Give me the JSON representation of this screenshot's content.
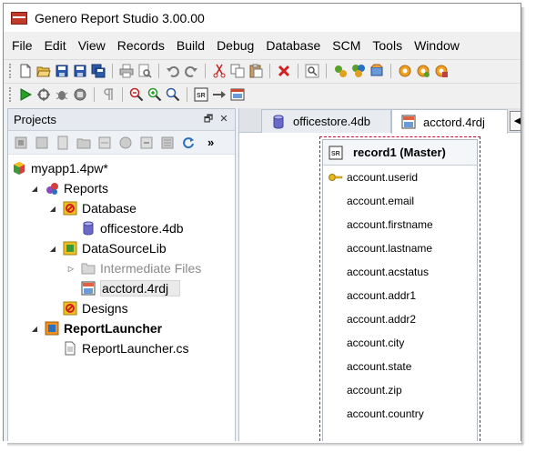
{
  "window": {
    "title": "Genero Report Studio 3.00.00"
  },
  "menu": [
    "File",
    "Edit",
    "View",
    "Records",
    "Build",
    "Debug",
    "Database",
    "SCM",
    "Tools",
    "Window"
  ],
  "toolbar_row1_icons": [
    "new-file-icon",
    "open-folder-icon",
    "save-icon",
    "save-as-icon",
    "save-all-icon",
    "print-icon",
    "print-preview-icon",
    "undo-icon",
    "redo-icon",
    "cut-icon",
    "copy-icon",
    "paste-icon",
    "delete-icon",
    "find-icon",
    "compile-icon",
    "compile-all-icon",
    "package-icon",
    "settings-gear-icon",
    "settings-gear-2-icon",
    "settings-gear-3-icon"
  ],
  "toolbar_row2_icons": [
    "run-icon",
    "debug-step-icon",
    "bug-icon",
    "stop-icon",
    "paragraph-icon",
    "zoom-out-icon",
    "zoom-in-icon",
    "zoom-fit-icon",
    "report-sr-icon",
    "arrow-right-icon",
    "report-output-icon"
  ],
  "projects_panel": {
    "title": "Projects",
    "header_buttons": {
      "restore": "🗗",
      "close": "✕"
    },
    "toolbar_icons": [
      "add-project-icon",
      "add-group-icon",
      "add-file-icon",
      "new-folder-icon",
      "import-icon",
      "build-icon",
      "remove-icon",
      "properties-icon",
      "refresh-icon"
    ],
    "toolbar_overflow": "»",
    "tree": [
      {
        "label": "myapp1.4pw*",
        "icon": "project-cube-icon",
        "indent": 0,
        "expander": "",
        "bold": false,
        "dim": false,
        "selected": false
      },
      {
        "label": "Reports",
        "icon": "reports-group-icon",
        "indent": 1,
        "expander": "◢",
        "bold": false,
        "dim": false,
        "selected": false
      },
      {
        "label": "Database",
        "icon": "database-group-icon",
        "indent": 2,
        "expander": "◢",
        "bold": false,
        "dim": false,
        "selected": false
      },
      {
        "label": "officestore.4db",
        "icon": "database-file-icon",
        "indent": 3,
        "expander": "",
        "bold": false,
        "dim": false,
        "selected": false
      },
      {
        "label": "DataSourceLib",
        "icon": "datasource-lib-icon",
        "indent": 2,
        "expander": "◢",
        "bold": false,
        "dim": false,
        "selected": false
      },
      {
        "label": "Intermediate Files",
        "icon": "folder-icon",
        "indent": 3,
        "expander": "▷",
        "bold": false,
        "dim": true,
        "selected": false
      },
      {
        "label": "acctord.4rdj",
        "icon": "rdj-file-icon",
        "indent": 3,
        "expander": "",
        "bold": false,
        "dim": false,
        "selected": true
      },
      {
        "label": "Designs",
        "icon": "designs-group-icon",
        "indent": 2,
        "expander": "",
        "bold": false,
        "dim": false,
        "selected": false
      },
      {
        "label": "ReportLauncher",
        "icon": "report-launcher-icon",
        "indent": 1,
        "expander": "◢",
        "bold": true,
        "dim": false,
        "selected": false
      },
      {
        "label": "ReportLauncher.cs",
        "icon": "cs-file-icon",
        "indent": 2,
        "expander": "",
        "bold": false,
        "dim": false,
        "selected": false
      }
    ]
  },
  "editor": {
    "tabs": [
      {
        "label": "officestore.4db",
        "icon": "database-file-icon",
        "active": false
      },
      {
        "label": "acctord.4rdj",
        "icon": "rdj-file-icon",
        "active": true
      }
    ],
    "tab_scroll_left": "◀",
    "record": {
      "title": "record1 (Master)",
      "fields": [
        "account.userid",
        "account.email",
        "account.firstname",
        "account.lastname",
        "account.acstatus",
        "account.addr1",
        "account.addr2",
        "account.city",
        "account.state",
        "account.zip",
        "account.country"
      ],
      "key_field_index": 0
    }
  },
  "colors": {
    "record_border": "#cc0033",
    "panel_header": "#e6eaf0",
    "selection": "#eaeaea"
  }
}
